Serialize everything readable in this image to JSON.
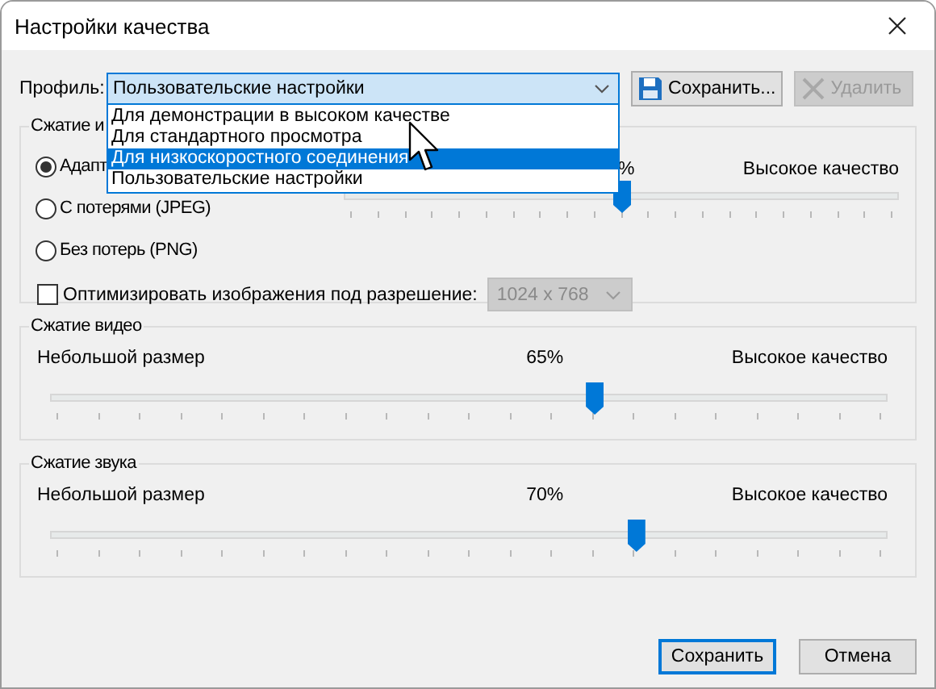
{
  "window": {
    "title": "Настройки качества"
  },
  "profile": {
    "label": "Профиль:",
    "value": "Пользовательские настройки",
    "expanded": true,
    "options": [
      {
        "label": "Для демонстрации в высоком качестве",
        "highlighted": false
      },
      {
        "label": "Для стандартного просмотра",
        "highlighted": false
      },
      {
        "label": "Для низкоскоростного соединения",
        "highlighted": true
      },
      {
        "label": "Пользовательские настройки",
        "highlighted": false
      }
    ]
  },
  "profile_buttons": [
    {
      "kind": "save",
      "label": "Сохранить...",
      "disabled": false
    },
    {
      "kind": "delete",
      "label": "Удалить",
      "disabled": true
    }
  ],
  "image_compression": {
    "title": "Сжатие и",
    "radios": [
      {
        "label": "Адапт",
        "selected": true
      },
      {
        "label": "С потерями (JPEG)",
        "selected": false
      },
      {
        "label": "Без потерь (PNG)",
        "selected": false
      }
    ],
    "slider": {
      "reading": "%",
      "right_label": "Высокое качество",
      "level": 0.5
    },
    "optimize": {
      "label": "Оптимизировать изображения под разрешение:",
      "checked": false
    },
    "resolution": {
      "value": "1024 x 768",
      "disabled": true
    }
  },
  "video_compression": {
    "title": "Сжатие видео",
    "left_label": "Небольшой размер",
    "reading": "65%",
    "right_label": "Высокое качество",
    "level": 0.65
  },
  "audio_compression": {
    "title": "Сжатие звука",
    "left_label": "Небольшой размер",
    "reading": "70%",
    "right_label": "Высокое качество",
    "level": 0.7
  },
  "buttons": [
    {
      "label": "Сохранить",
      "default": true
    },
    {
      "label": "Отмена",
      "default": false
    }
  ]
}
